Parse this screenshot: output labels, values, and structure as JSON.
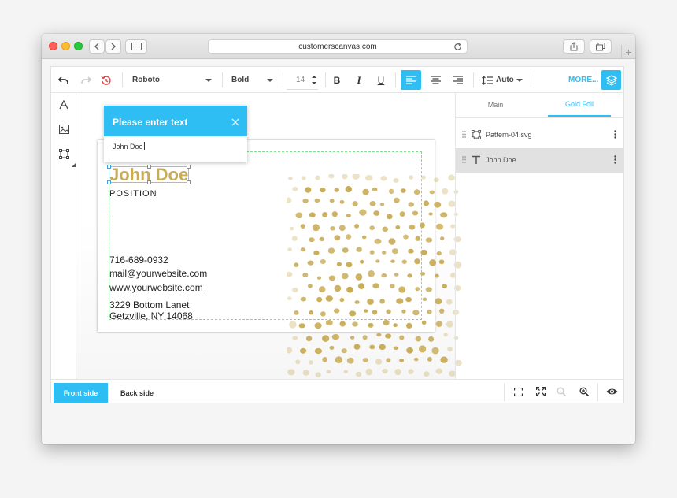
{
  "browser": {
    "url": "customerscanvas.com"
  },
  "toolbar": {
    "font_family": "Roboto",
    "font_weight": "Bold",
    "font_size": "14",
    "line_height": "Auto",
    "more_label": "MORE..."
  },
  "popup": {
    "title": "Please enter text",
    "value": "John Doe"
  },
  "card": {
    "name": "John Doe",
    "position": "POSITION",
    "phone": "716-689-0932",
    "email": "mail@yourwebsite.com",
    "website": "www.yourwebsite.com",
    "address_line1": "3229 Bottom Lanet",
    "address_line2": "Getzville, NY 14068"
  },
  "right_panel": {
    "tabs": [
      {
        "label": "Main",
        "active": false
      },
      {
        "label": "Gold Foil",
        "active": true
      }
    ],
    "layers": [
      {
        "label": "Pattern-04.svg",
        "icon": "shape-icon",
        "selected": false
      },
      {
        "label": "John Doe",
        "icon": "text-icon",
        "selected": true
      }
    ]
  },
  "bottom": {
    "front_label": "Front side",
    "back_label": "Back side"
  },
  "colors": {
    "accent": "#2fbef3",
    "gold": "#c8ac58",
    "guide": "#7ee08a"
  }
}
